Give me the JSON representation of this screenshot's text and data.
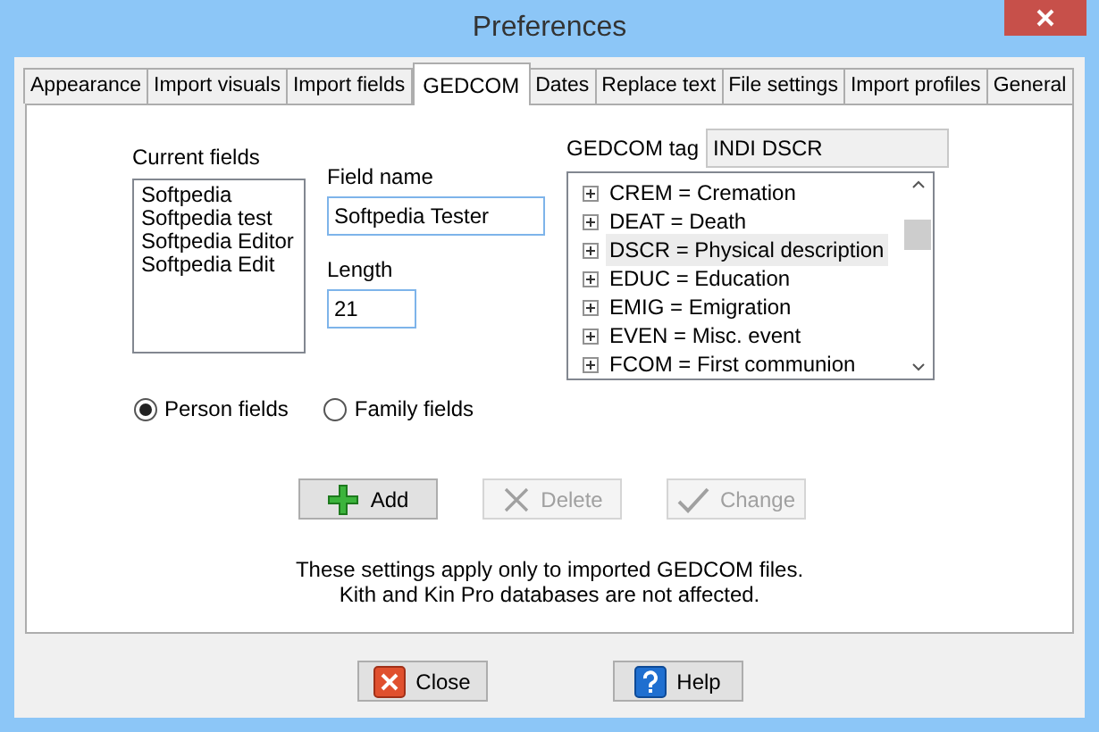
{
  "window": {
    "title": "Preferences"
  },
  "tabs": [
    {
      "label": "Appearance",
      "selected": false
    },
    {
      "label": "Import visuals",
      "selected": false
    },
    {
      "label": "Import fields",
      "selected": false
    },
    {
      "label": "GEDCOM",
      "selected": true
    },
    {
      "label": "Dates",
      "selected": false
    },
    {
      "label": "Replace text",
      "selected": false
    },
    {
      "label": "File settings",
      "selected": false
    },
    {
      "label": "Import profiles",
      "selected": false
    },
    {
      "label": "General",
      "selected": false
    }
  ],
  "current_fields": {
    "label": "Current fields",
    "items": [
      "Softpedia",
      "Softpedia test",
      "Softpedia Editor",
      "Softpedia Edit"
    ]
  },
  "field_name": {
    "label": "Field name",
    "value": "Softpedia Tester"
  },
  "length": {
    "label": "Length",
    "value": "21"
  },
  "field_type": [
    {
      "label": "Person fields",
      "selected": true
    },
    {
      "label": "Family fields",
      "selected": false
    }
  ],
  "gedcom_tag": {
    "label": "GEDCOM tag",
    "value": "INDI DSCR"
  },
  "tag_tree": [
    {
      "label": "CREM = Cremation",
      "selected": false
    },
    {
      "label": "DEAT = Death",
      "selected": false
    },
    {
      "label": "DSCR = Physical description",
      "selected": true
    },
    {
      "label": "EDUC = Education",
      "selected": false
    },
    {
      "label": "EMIG = Emigration",
      "selected": false
    },
    {
      "label": "EVEN = Misc. event",
      "selected": false
    },
    {
      "label": "FCOM = First communion",
      "selected": false
    }
  ],
  "actions": [
    {
      "kind": "add",
      "label": "Add",
      "disabled": false
    },
    {
      "kind": "delete",
      "label": "Delete",
      "disabled": true
    },
    {
      "kind": "change",
      "label": "Change",
      "disabled": true
    }
  ],
  "note": [
    "These settings apply only to imported GEDCOM files.",
    "Kith and Kin Pro databases are not affected."
  ],
  "footer_buttons": [
    {
      "kind": "close",
      "label": "Close"
    },
    {
      "kind": "help",
      "label": "Help"
    }
  ]
}
